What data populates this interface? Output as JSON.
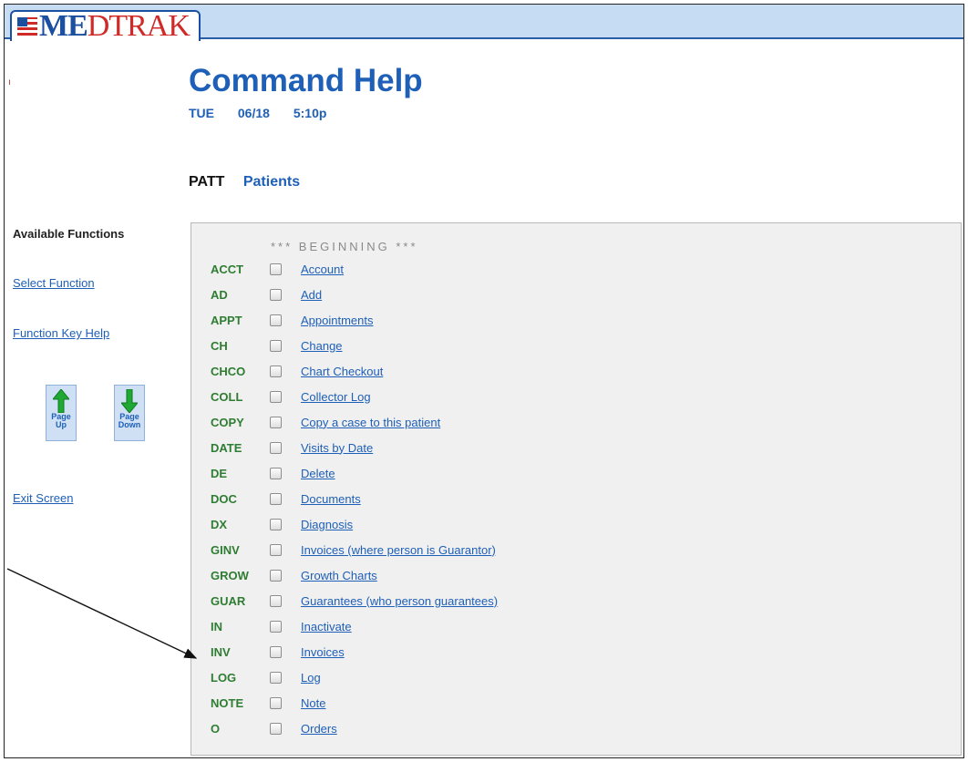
{
  "app": {
    "logo_text": "MEDTRAK",
    "logo_me": "ME",
    "logo_rest": "DTRAK"
  },
  "header": {
    "title": "Command Help",
    "day": "TUE",
    "date": "06/18",
    "time": "5:10p"
  },
  "command": {
    "code": "PATT",
    "name": "Patients"
  },
  "sidebar": {
    "heading": "Available Functions",
    "select_function": "Select Function",
    "function_key_help": "Function Key Help",
    "page_up": [
      "Page",
      "Up"
    ],
    "page_down": [
      "Page",
      "Down"
    ],
    "exit_screen": "Exit Screen"
  },
  "list": {
    "beginning_label": "*** BEGINNING ***",
    "items": [
      {
        "code": "ACCT",
        "label": "Account"
      },
      {
        "code": "AD",
        "label": "Add"
      },
      {
        "code": "APPT",
        "label": "Appointments"
      },
      {
        "code": "CH",
        "label": "Change"
      },
      {
        "code": "CHCO",
        "label": "Chart Checkout"
      },
      {
        "code": "COLL",
        "label": "Collector Log"
      },
      {
        "code": "COPY",
        "label": "Copy a case to this patient"
      },
      {
        "code": "DATE",
        "label": "Visits by Date"
      },
      {
        "code": "DE",
        "label": "Delete"
      },
      {
        "code": "DOC",
        "label": "Documents"
      },
      {
        "code": "DX",
        "label": "Diagnosis"
      },
      {
        "code": "GINV",
        "label": "Invoices (where person is Guarantor)"
      },
      {
        "code": "GROW",
        "label": "Growth Charts"
      },
      {
        "code": "GUAR",
        "label": "Guarantees (who person guarantees)"
      },
      {
        "code": "IN",
        "label": "Inactivate"
      },
      {
        "code": "INV",
        "label": "Invoices"
      },
      {
        "code": "LOG",
        "label": "Log"
      },
      {
        "code": "NOTE",
        "label": "Note"
      },
      {
        "code": "O",
        "label": "Orders"
      }
    ]
  },
  "colors": {
    "accent_blue": "#1e5fb8",
    "code_green": "#2e7d32",
    "topbar": "#c6dcf3",
    "panel_bg": "#f0f0f0",
    "arrow_green": "#1fa832"
  }
}
